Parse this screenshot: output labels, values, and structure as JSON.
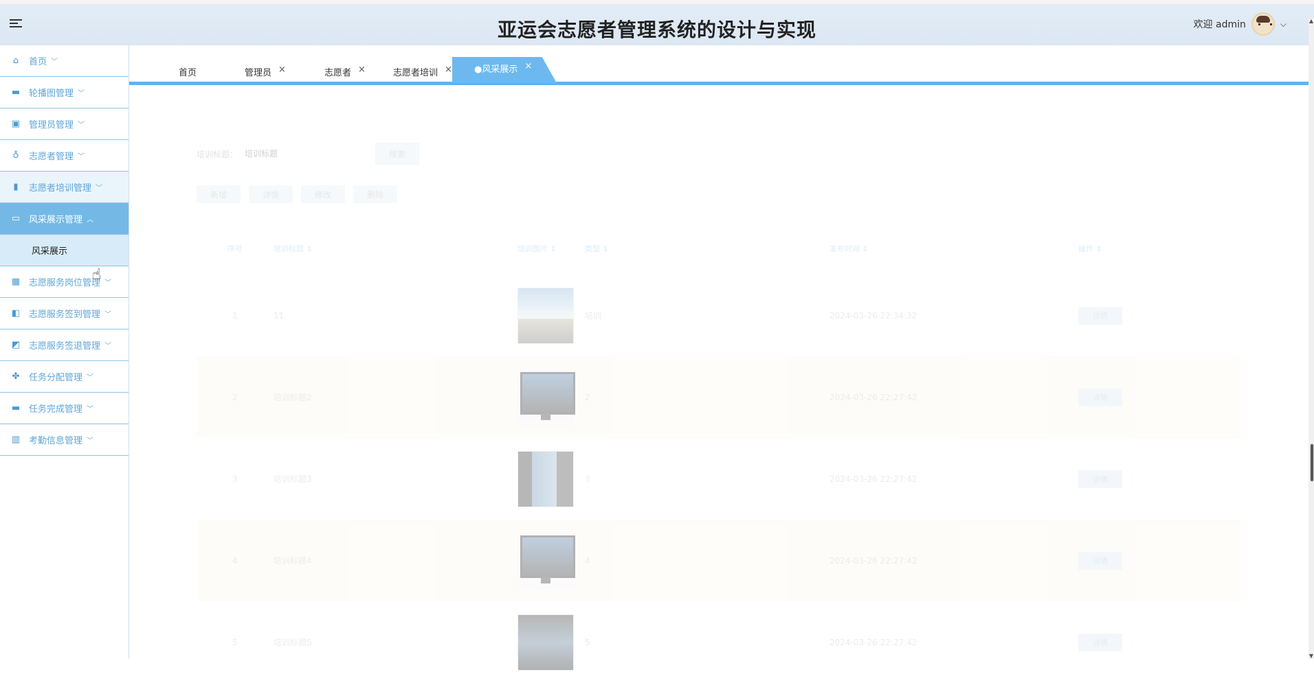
{
  "header": {
    "title": "亚运会志愿者管理系统的设计与实现",
    "welcome": "欢迎 admin"
  },
  "sidebar": {
    "items": [
      {
        "label": "首页",
        "icon": "home-icon",
        "state": "normal"
      },
      {
        "label": "轮播图管理",
        "icon": "carousel-icon",
        "state": "normal"
      },
      {
        "label": "管理员管理",
        "icon": "chip-icon",
        "state": "normal"
      },
      {
        "label": "志愿者管理",
        "icon": "award-icon",
        "state": "normal"
      },
      {
        "label": "志愿者培训管理",
        "icon": "bookmark-icon",
        "state": "faded"
      },
      {
        "label": "风采展示管理",
        "icon": "monitor-icon",
        "state": "active"
      },
      {
        "label": "志愿服务岗位管理",
        "icon": "grid-icon",
        "state": "normal"
      },
      {
        "label": "志愿服务签到管理",
        "icon": "panel-icon",
        "state": "normal"
      },
      {
        "label": "志愿服务签退管理",
        "icon": "badge-icon",
        "state": "normal"
      },
      {
        "label": "任务分配管理",
        "icon": "apps-icon",
        "state": "normal"
      },
      {
        "label": "任务完成管理",
        "icon": "laptop-icon",
        "state": "normal"
      },
      {
        "label": "考勤信息管理",
        "icon": "book-icon",
        "state": "normal"
      }
    ],
    "sub_item": "风采展示"
  },
  "tabs": [
    {
      "label": "首页",
      "closable": false
    },
    {
      "label": "管理员",
      "closable": true
    },
    {
      "label": "志愿者",
      "closable": true
    },
    {
      "label": "志愿者培训",
      "closable": true
    },
    {
      "label": "●风采展示",
      "closable": true,
      "active": true
    }
  ],
  "search": {
    "label": "培训标题：",
    "placeholder": "培训标题",
    "button": "搜索"
  },
  "actions": [
    "新增",
    "详情",
    "修改",
    "删除"
  ],
  "table": {
    "headers": [
      "序号",
      "培训标题 ⇕",
      "培训图片 ⇕",
      "类型 ⇕",
      "发布时间 ⇕",
      "操作 ⇕"
    ],
    "rows": [
      {
        "idx": "1",
        "title": "11",
        "image": "sky",
        "type": "培训",
        "time": "2024-03-26 22:34:32",
        "op": "详情"
      },
      {
        "idx": "2",
        "title": "培训标题2",
        "image": "monitor",
        "type": "2",
        "time": "2024-03-26 22:27:42",
        "op": "详情"
      },
      {
        "idx": "3",
        "title": "培训标题3",
        "image": "screen",
        "type": "3",
        "time": "2024-03-26 22:27:42",
        "op": "详情"
      },
      {
        "idx": "4",
        "title": "培训标题4",
        "image": "monitor",
        "type": "4",
        "time": "2024-03-26 22:27:42",
        "op": "详情"
      },
      {
        "idx": "5",
        "title": "培训标题5",
        "image": "dark",
        "type": "5",
        "time": "2024-03-26 22:27:42",
        "op": "详情"
      }
    ]
  }
}
